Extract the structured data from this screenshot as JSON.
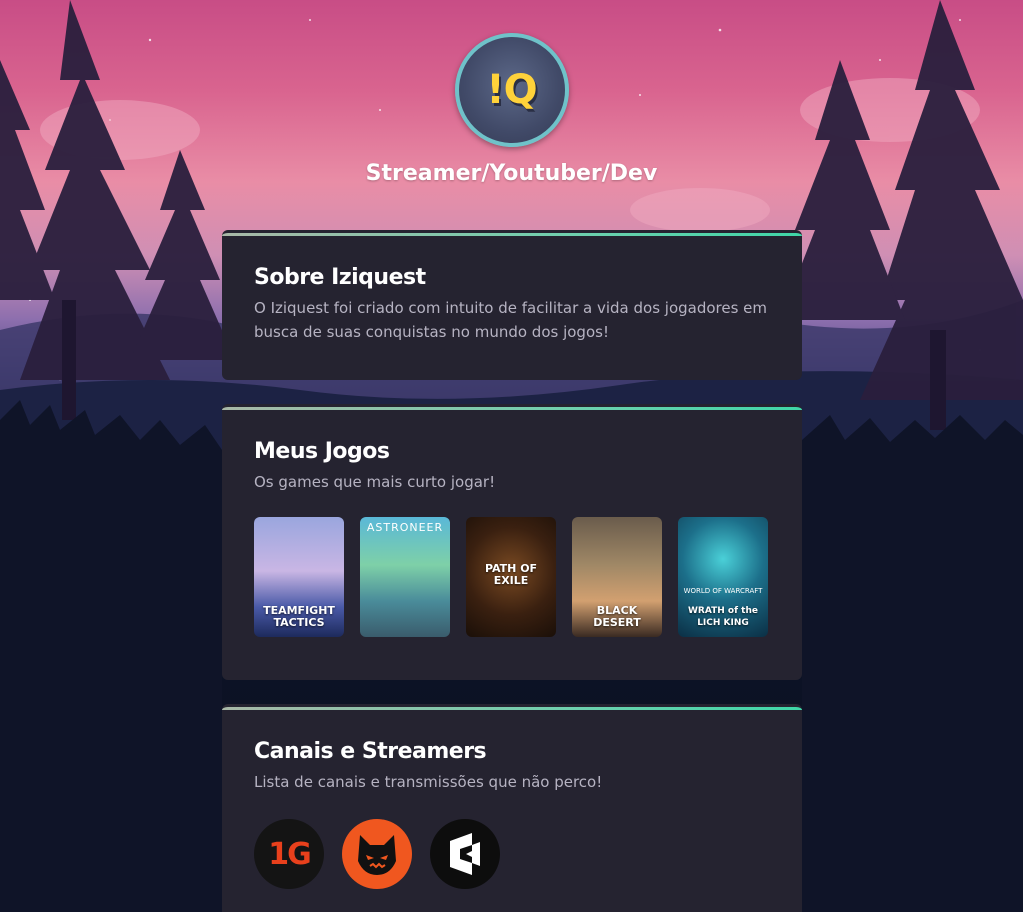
{
  "profile": {
    "avatar_text": "!Q",
    "tagline": "Streamer/Youtuber/Dev"
  },
  "about": {
    "title": "Sobre Iziquest",
    "description": "O Iziquest foi criado com intuito de facilitar a vida dos jogadores em busca de suas conquistas no mundo dos jogos!"
  },
  "games": {
    "title": "Meus Jogos",
    "subtitle": "Os games que mais curto jogar!",
    "items": [
      {
        "label": "TEAMFIGHT TACTICS",
        "top": ""
      },
      {
        "label": "",
        "top": "ASTRONEER"
      },
      {
        "label": "PATH OF EXILE",
        "top": ""
      },
      {
        "label": "BLACK DESERT",
        "top": ""
      },
      {
        "label": "WRATH of the LICH KING",
        "top": "WORLD OF WARCRAFT"
      }
    ]
  },
  "streamers": {
    "title": "Canais e Streamers",
    "subtitle": "Lista de canais e transmissões que não perco!",
    "items": [
      {
        "logo_text": "1G",
        "icon": "1g-logo-icon"
      },
      {
        "logo_text": "",
        "icon": "cat-mask-logo-icon"
      },
      {
        "logo_text": "",
        "icon": "tilted-logo-icon"
      }
    ]
  },
  "colors": {
    "card_bg": "#252330",
    "accent": "#3fd6a8",
    "title": "#ffffff",
    "body_text": "#b6b3c2"
  }
}
